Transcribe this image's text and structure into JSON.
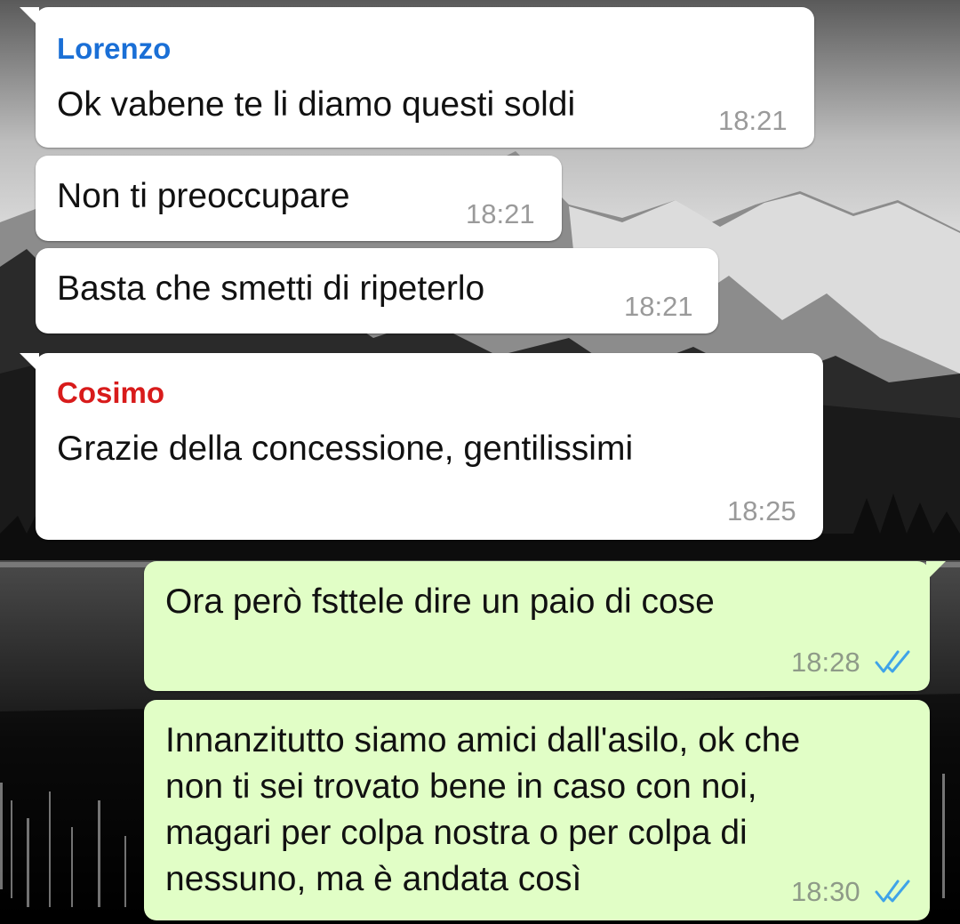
{
  "colors": {
    "incoming_bubble": "#ffffff",
    "outgoing_bubble": "#e1fec6",
    "sender_lorenzo": "#1a6fd6",
    "sender_cosimo": "#d81b1b",
    "read_ticks": "#3fa3e8",
    "timestamp": "#9a9a9a"
  },
  "wallpaper": {
    "description_icon": "mountain-lake-wallpaper"
  },
  "messages": [
    {
      "direction": "incoming",
      "sender": "Lorenzo",
      "text": "Ok vabene te li diamo questi soldi",
      "time": "18:21"
    },
    {
      "direction": "incoming",
      "text": "Non ti preoccupare",
      "time": "18:21"
    },
    {
      "direction": "incoming",
      "text": "Basta che smetti di ripeterlo",
      "time": "18:21"
    },
    {
      "direction": "incoming",
      "sender": "Cosimo",
      "text": "Grazie della concessione, gentilissimi",
      "time": "18:25"
    },
    {
      "direction": "outgoing",
      "text": "Ora però fsttele dire un paio di cose",
      "time": "18:28",
      "status": "read"
    },
    {
      "direction": "outgoing",
      "text": "Innanzitutto siamo amici dall'asilo, ok che\nnon ti sei trovato bene in caso con noi,\nmagari per colpa nostra o per colpa di\nnessuno, ma è andata così",
      "time": "18:30",
      "status": "read"
    }
  ]
}
